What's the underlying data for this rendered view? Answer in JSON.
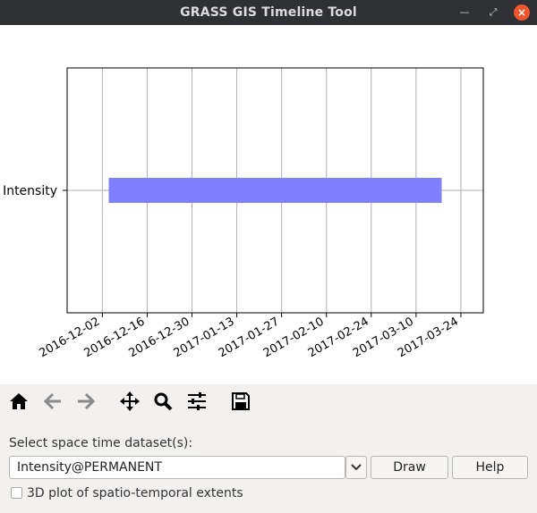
{
  "window": {
    "title": "GRASS GIS Timeline Tool",
    "min_glyph": "—",
    "max_glyph": "⤢",
    "close_glyph": "×"
  },
  "chart_data": {
    "type": "timeline",
    "y_categories": [
      "Intensity"
    ],
    "x_ticks": [
      "2016-12-02",
      "2016-12-16",
      "2016-12-30",
      "2017-01-13",
      "2017-01-27",
      "2017-02-10",
      "2017-02-24",
      "2017-03-10",
      "2017-03-24"
    ],
    "xlim": [
      "2016-11-21",
      "2017-03-31"
    ],
    "series": [
      {
        "name": "Intensity",
        "start": "2016-12-04",
        "end": "2017-03-18"
      }
    ],
    "bar_color": "#8080ff",
    "grid": true
  },
  "toolbar": {
    "home": "home-icon",
    "back": "back-arrow-icon",
    "forward": "forward-arrow-icon",
    "pan": "pan-icon",
    "zoom": "zoom-icon",
    "configure": "configure-subplots-icon",
    "save": "save-icon"
  },
  "form": {
    "dataset_label": "Select space time dataset(s):",
    "dataset_value": "Intensity@PERMANENT",
    "draw_label": "Draw",
    "help_label": "Help",
    "plot3d_label": "3D plot of spatio-temporal extents",
    "plot3d_checked": false
  }
}
